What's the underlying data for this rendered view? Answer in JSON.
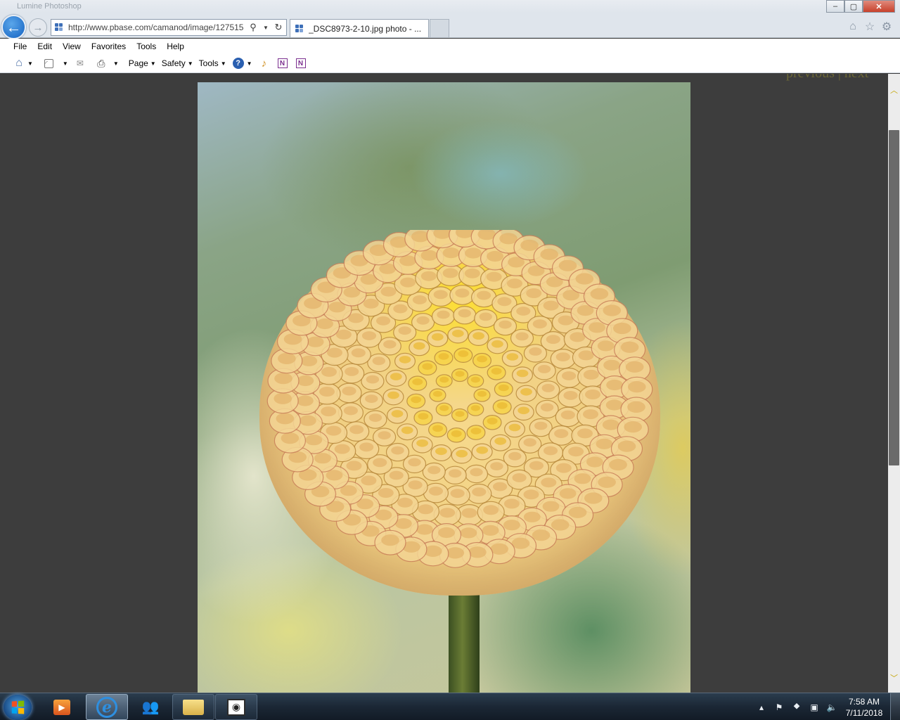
{
  "window": {
    "title": "Lumine Photoshop",
    "buttons": {
      "minimize": "‒",
      "maximize": "▢",
      "close": "✕"
    }
  },
  "browser": {
    "back_label": "←",
    "forward_label": "→",
    "address": "http://www.pbase.com/camanod/image/127515",
    "address_domain": "pbase.com",
    "tab_title": "_DSC8973-2-10.jpg photo - ..."
  },
  "right_icons": [
    "home-icon",
    "favorites-star-icon",
    "settings-gear-icon"
  ],
  "menu": {
    "items": [
      "File",
      "Edit",
      "View",
      "Favorites",
      "Tools",
      "Help"
    ]
  },
  "command_bar": {
    "page_label": "Page",
    "safety_label": "Safety",
    "tools_label": "Tools"
  },
  "content": {
    "prev_next": "previous | next",
    "photo_alt": "_DSC8973-2-10.jpg"
  },
  "taskbar": {
    "clock_time": "7:58 AM",
    "clock_date": "7/11/2018"
  },
  "colors": {
    "background": "#3d3d3d",
    "accent": "#c4a400",
    "taskbar": "#1b2735"
  }
}
